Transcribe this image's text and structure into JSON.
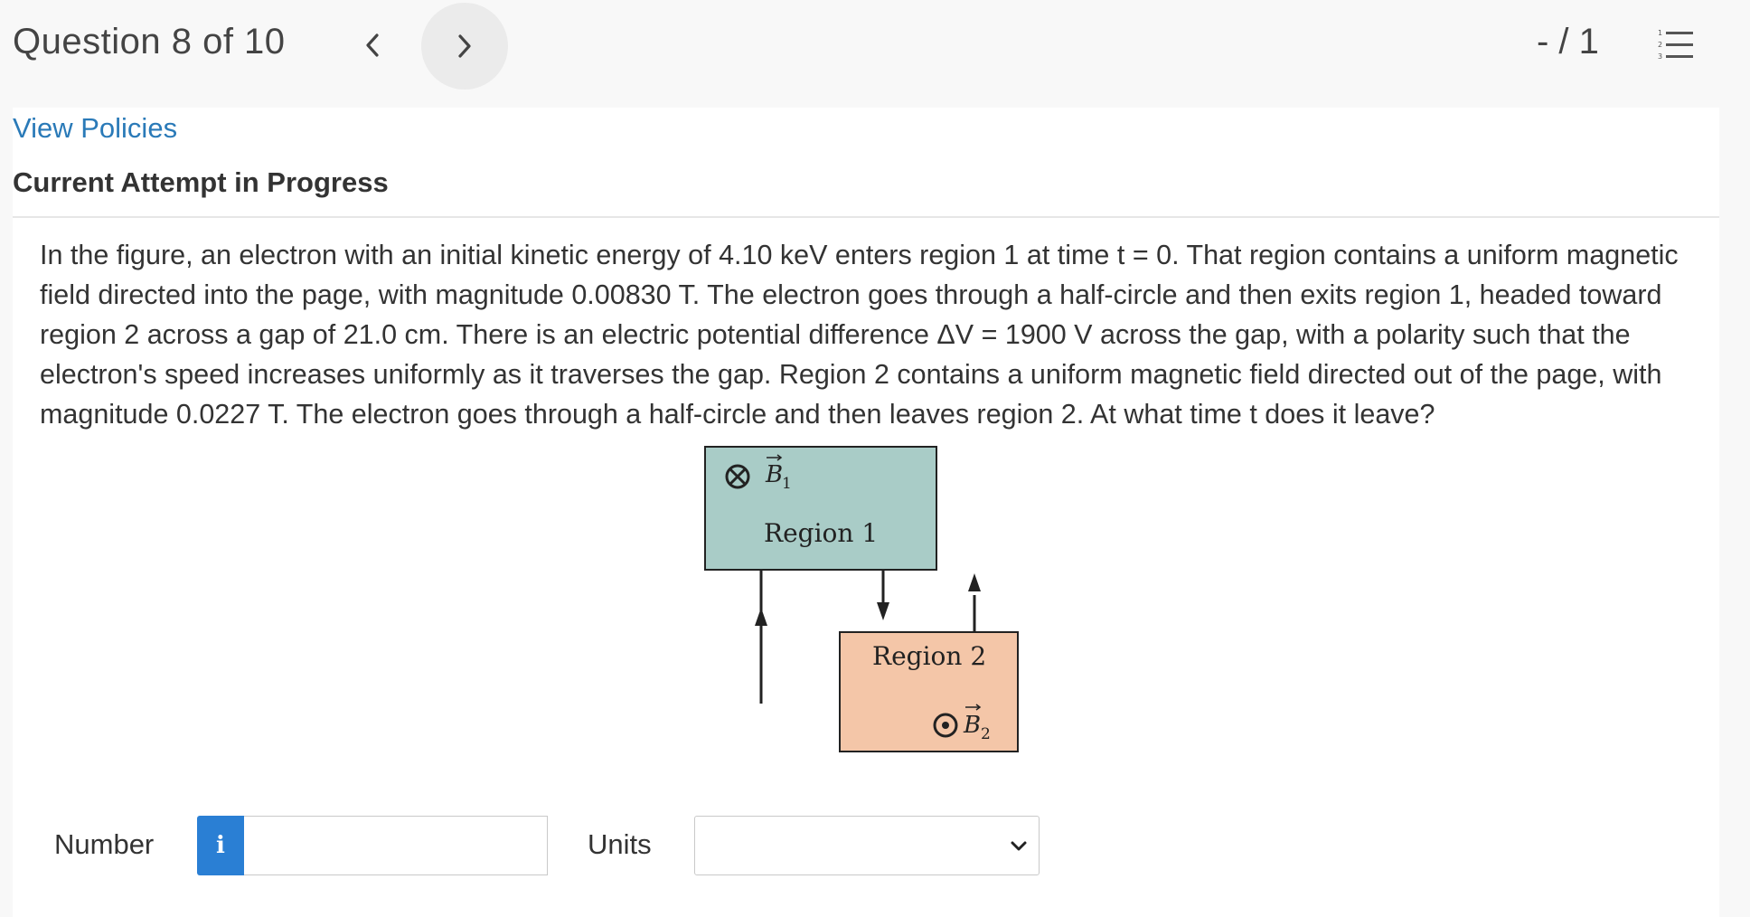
{
  "header": {
    "question_counter": "Question 8 of 10",
    "score": "- / 1",
    "prev_icon": "chevron-left-icon",
    "next_icon": "chevron-right-icon",
    "list_icon": "numbered-list-icon"
  },
  "links": {
    "view_policies": "View Policies"
  },
  "status": {
    "attempt": "Current Attempt in Progress"
  },
  "question": {
    "text": "In the figure, an electron with an initial kinetic energy of 4.10 keV enters region 1 at time t = 0. That region contains a uniform magnetic field directed into the page, with magnitude 0.00830 T. The electron goes through a half-circle and then exits region 1, headed toward region 2 across a gap of 21.0 cm. There is an electric potential difference ΔV = 1900 V across the gap, with a polarity such that the electron's speed increases uniformly as it traverses the gap. Region 2 contains a uniform magnetic field directed out of the page, with magnitude 0.0227 T. The electron goes through a half-circle and then leaves region 2. At what time t does it leave?"
  },
  "figure": {
    "region1_label": "Region 1",
    "region2_label": "Region 2",
    "b1_symbol": "B",
    "b1_subscript": "1",
    "b2_symbol": "B",
    "b2_subscript": "2",
    "region1_color": "#a9ccc7",
    "region2_color": "#f4c6a8"
  },
  "answer": {
    "number_label": "Number",
    "number_value": "",
    "info_icon": "info-icon",
    "info_label": "i",
    "units_label": "Units",
    "units_selected": ""
  },
  "colors": {
    "link": "#2a7ab8",
    "info_button": "#2a7fd4",
    "header_bg": "#f8f8f8"
  }
}
